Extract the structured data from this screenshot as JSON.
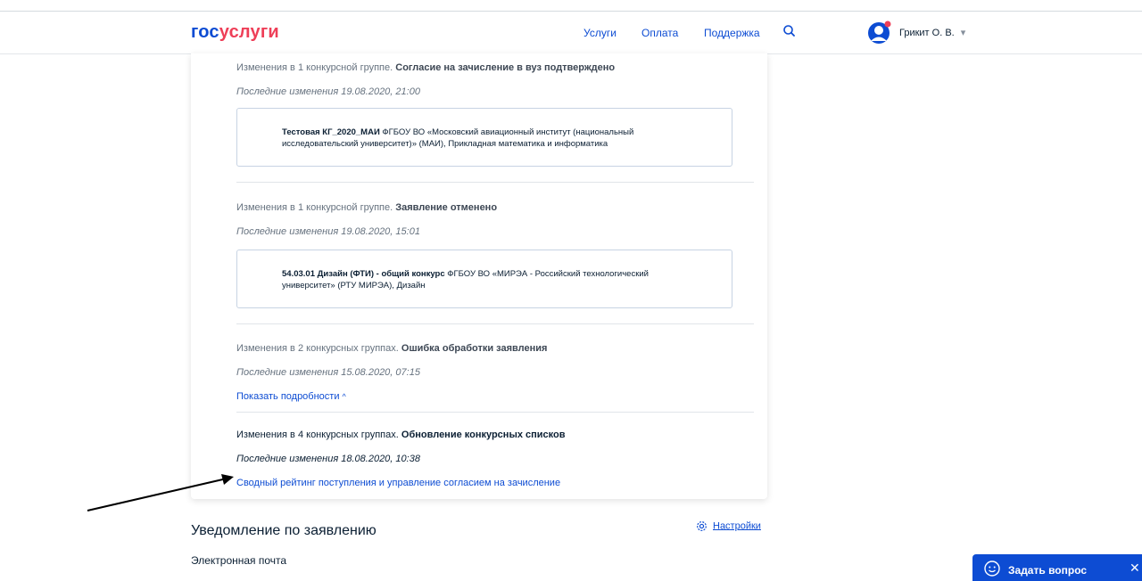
{
  "header": {
    "logo_part1": "гос",
    "logo_part2": "услуги",
    "nav": [
      "Услуги",
      "Оплата",
      "Поддержка"
    ],
    "user_name": "Грикит О. В.",
    "user_caret": "▾"
  },
  "events": [
    {
      "title_prefix": "Изменения в 1 конкурсной группе.",
      "title_bold": "Согласие на зачисление в вуз подтверждено",
      "date": "Последние изменения 19.08.2020, 21:00",
      "group_bold": "Тестовая КГ_2020_МАИ",
      "group_text": "ФГБОУ ВО «Московский авиационный институт (национальный исследовательский университет)» (МАИ), Прикладная математика и информатика"
    },
    {
      "title_prefix": "Изменения в 1 конкурсной группе.",
      "title_bold": "Заявление отменено",
      "date": "Последние изменения 19.08.2020, 15:01",
      "group_bold": "54.03.01 Дизайн (ФТИ) - общий конкурс",
      "group_text": "ФГБОУ ВО «МИРЭА - Российский технологический университет» (РТУ МИРЭА), Дизайн"
    },
    {
      "title_prefix": "Изменения в 2 конкурсных группах.",
      "title_bold": "Ошибка обработки заявления",
      "date": "Последние изменения 15.08.2020, 07:15",
      "link": "Показать подробности",
      "link_chevron": "^"
    },
    {
      "title_prefix": "Изменения в 4 конкурсных группах.",
      "title_bold": "Обновление конкурсных списков",
      "date": "Последние изменения 18.08.2020, 10:38",
      "link": "Сводный рейтинг поступления и управление согласием на зачисление"
    }
  ],
  "notifications": {
    "title": "Уведомление по заявлению",
    "settings_label": "Настройки",
    "email_label": "Электронная почта"
  },
  "chat": {
    "label": "Задать вопрос",
    "close": "✕"
  },
  "colors": {
    "brand_blue": "#0d4cd3",
    "brand_red": "#ee3f58",
    "text_dark": "#0b1f33",
    "text_muted": "#66727f"
  },
  "icons": [
    "search-icon",
    "avatar-icon",
    "notification-dot-icon",
    "gear-icon",
    "chat-face-icon",
    "close-icon",
    "arrow-annotation"
  ]
}
